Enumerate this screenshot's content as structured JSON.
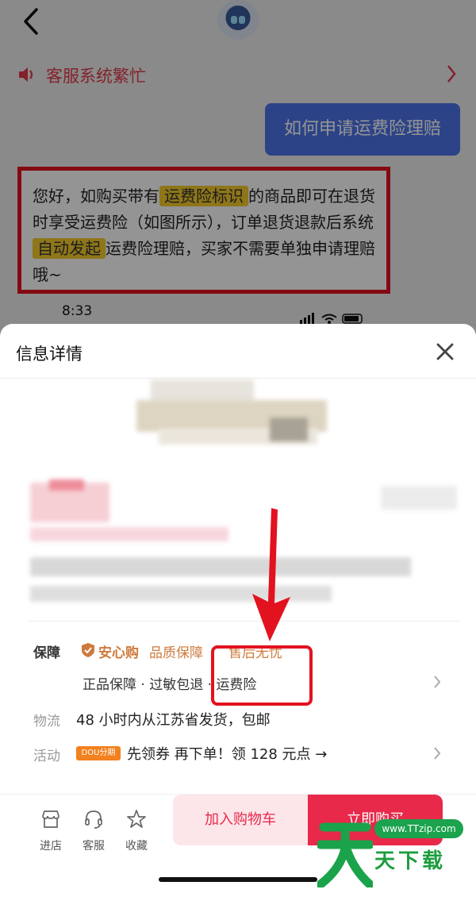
{
  "chat": {
    "notice": "客服系统繁忙",
    "question": "如何申请运费险理赔",
    "answer_parts": {
      "p1": "您好，如购买带有",
      "h1": "运费险标识",
      "p2": "的商品即可在退货时享受运费险（如图所示），订单退货退款后系统",
      "h2": "自动发起",
      "p3": "运费险理赔，买家不需要单独申请理赔哦~"
    },
    "status_time": "8:33"
  },
  "sheet": {
    "title": "信息详情",
    "guarantee": {
      "label": "保障",
      "brand": "安心购",
      "tag1": "品质保障",
      "tag2": "售后无忧",
      "items": "正品保障 · 过敏包退 · 运费险"
    },
    "shipping": {
      "label": "物流",
      "text": "48 小时内从江苏省发货，包邮"
    },
    "promotion": {
      "label": "活动",
      "badge": "DOU分期",
      "text": "先领券 再下单！领 128 元点 →"
    }
  },
  "actions": {
    "store": "进店",
    "service": "客服",
    "favorite": "收藏",
    "add_to_cart": "加入购物车",
    "buy_now": "立即购买"
  },
  "watermark": {
    "url": "www.TTzip.com",
    "text": "天下载"
  },
  "colors": {
    "accent_red": "#e8294a",
    "guarantee_orange": "#ce7a3c",
    "question_blue": "#4d74e8",
    "highlight_yellow": "#f5cc2c",
    "watermark_green": "#1e9d3f"
  }
}
